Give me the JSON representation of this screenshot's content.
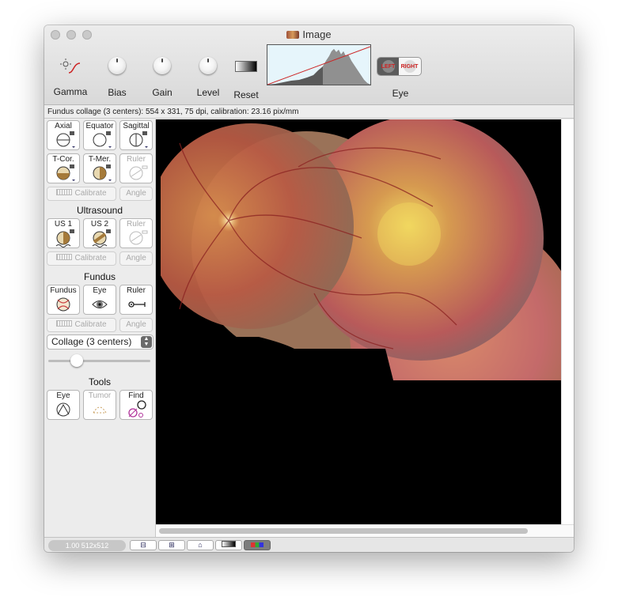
{
  "window": {
    "title": "Image"
  },
  "toolbar": {
    "gamma": "Gamma",
    "bias": "Bias",
    "gain": "Gain",
    "level": "Level",
    "reset": "Reset",
    "eye": "Eye",
    "eye_left": "LEFT",
    "eye_right": "RIGHT"
  },
  "info": "Fundus collage (3 centers): 554 x 331, 75 dpi, calibration: 23.16 pix/mm",
  "ct": {
    "axial": "Axial",
    "equator": "Equator",
    "sagittal": "Sagittal",
    "tcor": "T-Cor.",
    "tmer": "T-Mer.",
    "ruler": "Ruler",
    "calibrate": "Calibrate",
    "angle": "Angle"
  },
  "ultrasound": {
    "title": "Ultrasound",
    "us1": "US 1",
    "us2": "US 2",
    "ruler": "Ruler",
    "calibrate": "Calibrate",
    "angle": "Angle"
  },
  "fundus": {
    "title": "Fundus",
    "fundus": "Fundus",
    "eye": "Eye",
    "ruler": "Ruler",
    "calibrate": "Calibrate",
    "angle": "Angle",
    "mode": "Collage (3 centers)"
  },
  "tools": {
    "title": "Tools",
    "eye": "Eye",
    "tumor": "Tumor",
    "find": "Find"
  },
  "statusbar": {
    "zoom": "1.00 512x512"
  },
  "colors": {
    "window_bg": "#ececec",
    "view_bg": "#000000",
    "accent_red": "#cc2222"
  }
}
